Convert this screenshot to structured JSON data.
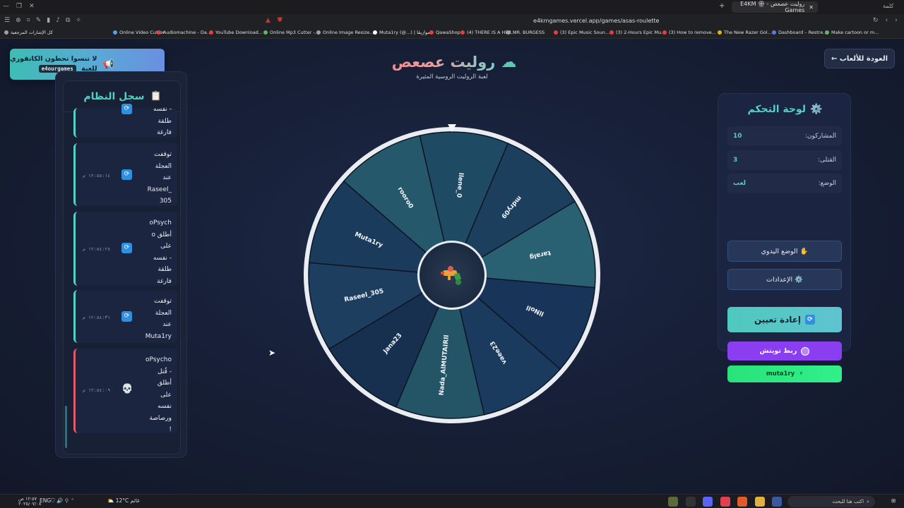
{
  "browser": {
    "tab_title": "روليت عصعص - 🎡 E4KM Games",
    "url": "e4kmgames.vercel.app/games/asas-roulette",
    "titlebar_right": "كلمة",
    "bookmarks": [
      {
        "label": "كل الإشارات المرجعية",
        "color": "#9aa0a6"
      },
      {
        "label": "Online Video Cutter",
        "color": "#5aa0e6"
      },
      {
        "label": "Audiomachine - Da...",
        "color": "#e04040"
      },
      {
        "label": "YouTube Download...",
        "color": "#e04040"
      },
      {
        "label": "Online Mp3 Cutter -...",
        "color": "#5cb85c"
      },
      {
        "label": "Online Image Resize...",
        "color": "#9aa0a6"
      },
      {
        "label": "Muta1ry (@...) | موازيڤا",
        "color": "#ffffff"
      },
      {
        "label": "QawaShop",
        "color": "#e04040"
      },
      {
        "label": "(4) THERE IS A HER...",
        "color": "#e04040"
      },
      {
        "label": "MR. BURGESS",
        "color": "#9aa0a6"
      },
      {
        "label": "(3) Epic Music Soun...",
        "color": "#e04040"
      },
      {
        "label": "(3) 2-Hours Epic Mu...",
        "color": "#e04040"
      },
      {
        "label": "(3) How to remove...",
        "color": "#e04040"
      },
      {
        "label": "The New Razer Gol...",
        "color": "#e0b020"
      },
      {
        "label": "Dashboard – Restre...",
        "color": "#5a7ae0"
      },
      {
        "label": "Make cartoon or m...",
        "color": "#5cb85c"
      }
    ]
  },
  "toast": {
    "line1": "لا تنسوا تحطون الكاتقوري",
    "line2": "للعبة",
    "code": "e4ourgames",
    "icon": "megaphone-icon"
  },
  "log": {
    "title": "سجل النظام",
    "icon": "clipboard-icon",
    "entries": [
      {
        "text": "نفسه -\nطلقة\nفارغة",
        "time": "",
        "type": "info"
      },
      {
        "text": "توقفت\nالعجلة\nعند\nRaseel_\n305",
        "time": "١٢:٥٥:١٤ م",
        "type": "info"
      },
      {
        "text": "oPsych\no أطلق\nعلى\nنفسه -\nطلقة\nفارغة",
        "time": "١٢:٥٤:٢٨ م",
        "type": "info"
      },
      {
        "text": "توقفت\nالعجلة\nعند\nMuta1ry",
        "time": "١٢:٥٤:٣١ م",
        "type": "info"
      },
      {
        "text": "oPsycho\nقُتل -\nأطلق\nعلى\nنفسه\nورصاصة\n!",
        "time": "١٢:٥٤:٠٩ م",
        "type": "danger"
      }
    ]
  },
  "header": {
    "title": "روليت عصعص",
    "subtitle": "لعبة الروليت الروسية المثيرة",
    "back_label": "← العودة للألعاب"
  },
  "wheel": {
    "segments": [
      {
        "name": "llene_0",
        "color": "#1f4a63"
      },
      {
        "name": "mdry09",
        "color": "#1c3f5e"
      },
      {
        "name": "taralg",
        "color": "#2a6172"
      },
      {
        "name": "llNoll",
        "color": "#183458"
      },
      {
        "name": "vaee23",
        "color": "#1a3a5e"
      },
      {
        "name": "Nada_AlMUTAIRIl",
        "color": "#235567"
      },
      {
        "name": "Jana23",
        "color": "#17304f"
      },
      {
        "name": "Raseel_305",
        "color": "#1e3e60"
      },
      {
        "name": "Muta1ry",
        "color": "#1b3b5c"
      },
      {
        "name": "rooro0",
        "color": "#24586a"
      }
    ],
    "center_icon": "water-gun-icon"
  },
  "control": {
    "title": "لوحة التحكم",
    "title_icon": "gear-icon",
    "stats": [
      {
        "label": "المشاركون:",
        "value": "10"
      },
      {
        "label": "القتلى:",
        "value": "3"
      },
      {
        "label": "الوضع:",
        "value": "لعب"
      }
    ],
    "manual_label": "✋ الوضع اليدوي",
    "settings_label": "⚙️ الإعدادات",
    "reset_label": "إعادة تعيين",
    "twitch_label": "ربط تويتش",
    "user_label": "muta1ry"
  },
  "taskbar": {
    "time": "١٢:٥٧ ص",
    "date": "٢٠٢٥/٠٧/٠٨",
    "lang": "ENG",
    "weather": "12°C",
    "weather_label": "غائم",
    "search_placeholder": "اكتب هنا للبحث"
  },
  "colors": {
    "accent": "#4fd1c5",
    "danger": "#e05a67",
    "twitch": "#8b3ef0",
    "green": "#29e27a"
  }
}
